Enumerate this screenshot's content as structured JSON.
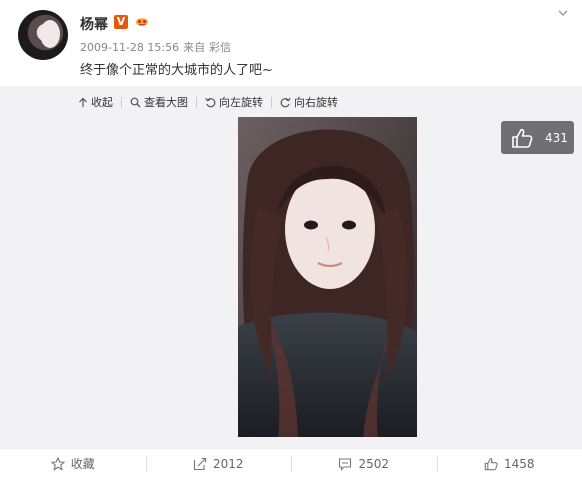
{
  "post": {
    "author": "杨幂",
    "badge": "V",
    "timestamp": "2009-11-28 15:56",
    "source_prefix": "来自",
    "source": "彩信",
    "text": "终于像个正常的大城市的人了吧~"
  },
  "toolbar": {
    "collapse": "收起",
    "view_large": "查看大图",
    "rotate_left": "向左旋转",
    "rotate_right": "向右旋转"
  },
  "image_like_count": "431",
  "footer": {
    "favorite": "收藏",
    "repost": "2012",
    "comment": "2502",
    "like": "1458"
  },
  "colors": {
    "verified_badge": "#e8580c",
    "media_background": "#f2f2f5"
  },
  "icons": [
    "avatar",
    "chevron-down-icon",
    "verified-icon",
    "member-icon",
    "collapse-icon",
    "magnifier-icon",
    "rotate-left-icon",
    "rotate-right-icon",
    "thumbs-up-icon",
    "star-icon",
    "repost-icon",
    "comment-icon"
  ]
}
